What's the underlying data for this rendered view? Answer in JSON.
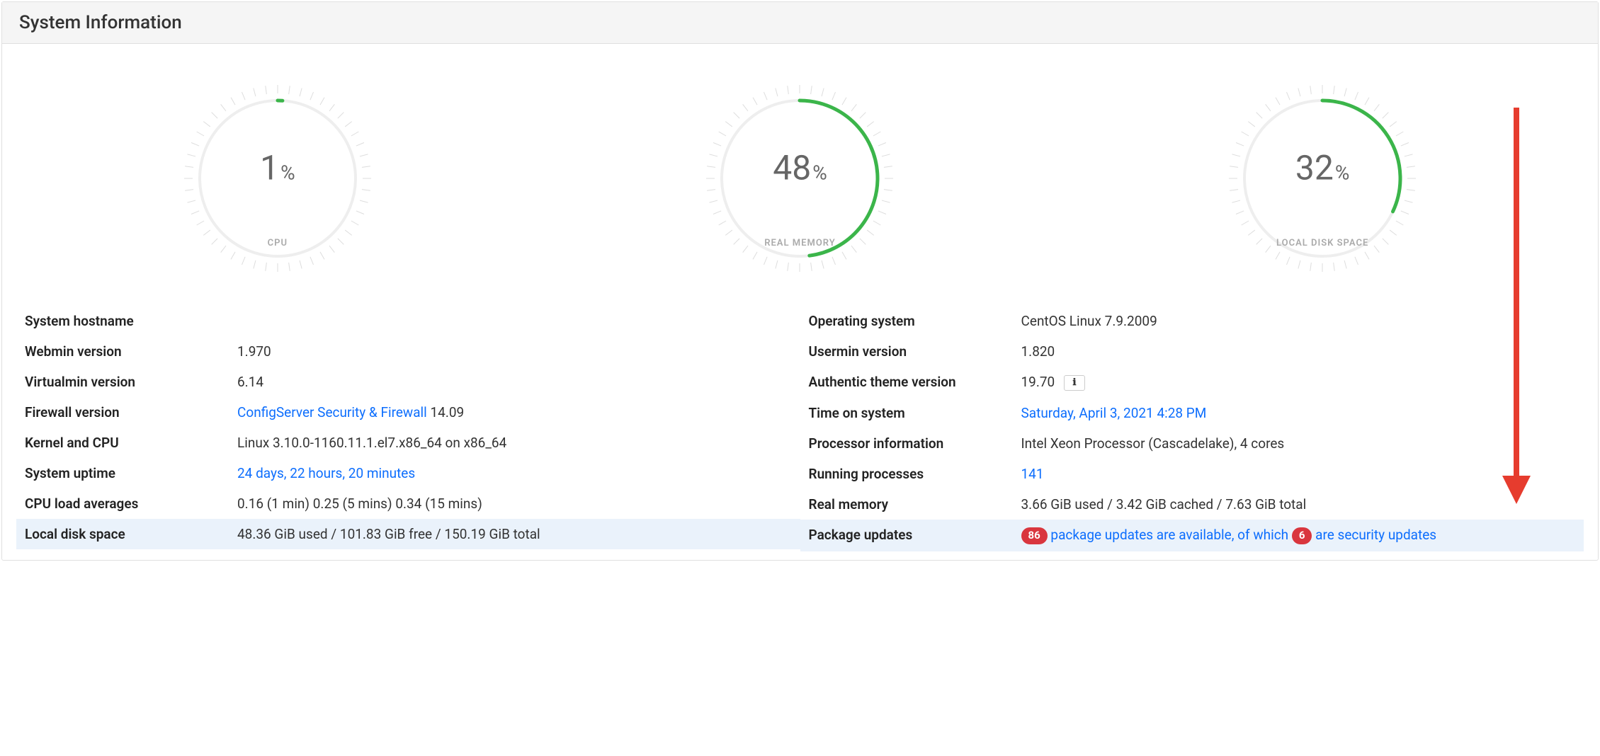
{
  "header": {
    "title": "System Information"
  },
  "gauges": {
    "cpu": {
      "value": 1,
      "unit": "%",
      "label": "CPU"
    },
    "memory": {
      "value": 48,
      "unit": "%",
      "label": "REAL MEMORY"
    },
    "disk": {
      "value": 32,
      "unit": "%",
      "label": "LOCAL DISK SPACE"
    }
  },
  "info": {
    "left": {
      "hostname_label": "System hostname",
      "hostname_value": "",
      "webmin_label": "Webmin version",
      "webmin_value": "1.970",
      "virtualmin_label": "Virtualmin version",
      "virtualmin_value": "6.14",
      "firewall_label": "Firewall version",
      "firewall_link": "ConfigServer Security & Firewall",
      "firewall_version": " 14.09",
      "kernel_label": "Kernel and CPU",
      "kernel_value": "Linux 3.10.0-1160.11.1.el7.x86_64 on x86_64",
      "uptime_label": "System uptime",
      "uptime_value": "24 days, 22 hours, 20 minutes",
      "load_label": "CPU load averages",
      "load_value": "0.16 (1 min) 0.25 (5 mins) 0.34 (15 mins)",
      "disk_label": "Local disk space",
      "disk_value": "48.36 GiB used / 101.83 GiB free / 150.19 GiB total"
    },
    "right": {
      "os_label": "Operating system",
      "os_value": "CentOS Linux 7.9.2009",
      "usermin_label": "Usermin version",
      "usermin_value": "1.820",
      "theme_label": "Authentic theme version",
      "theme_value": "19.70",
      "time_label": "Time on system",
      "time_value": "Saturday, April 3, 2021 4:28 PM",
      "cpu_label": "Processor information",
      "cpu_value": "Intel Xeon Processor (Cascadelake), 4 cores",
      "proc_label": "Running processes",
      "proc_value": "141",
      "mem_label": "Real memory",
      "mem_value": "3.66 GiB used / 3.42 GiB cached / 7.63 GiB total",
      "pkg_label": "Package updates",
      "pkg_badge1": "86",
      "pkg_text1": " package updates are available, of which ",
      "pkg_badge2": "6",
      "pkg_text2": " are security updates"
    }
  },
  "chart_data": [
    {
      "type": "gauge",
      "title": "CPU",
      "value": 1,
      "max": 100,
      "unit": "%"
    },
    {
      "type": "gauge",
      "title": "REAL MEMORY",
      "value": 48,
      "max": 100,
      "unit": "%"
    },
    {
      "type": "gauge",
      "title": "LOCAL DISK SPACE",
      "value": 32,
      "max": 100,
      "unit": "%"
    }
  ]
}
